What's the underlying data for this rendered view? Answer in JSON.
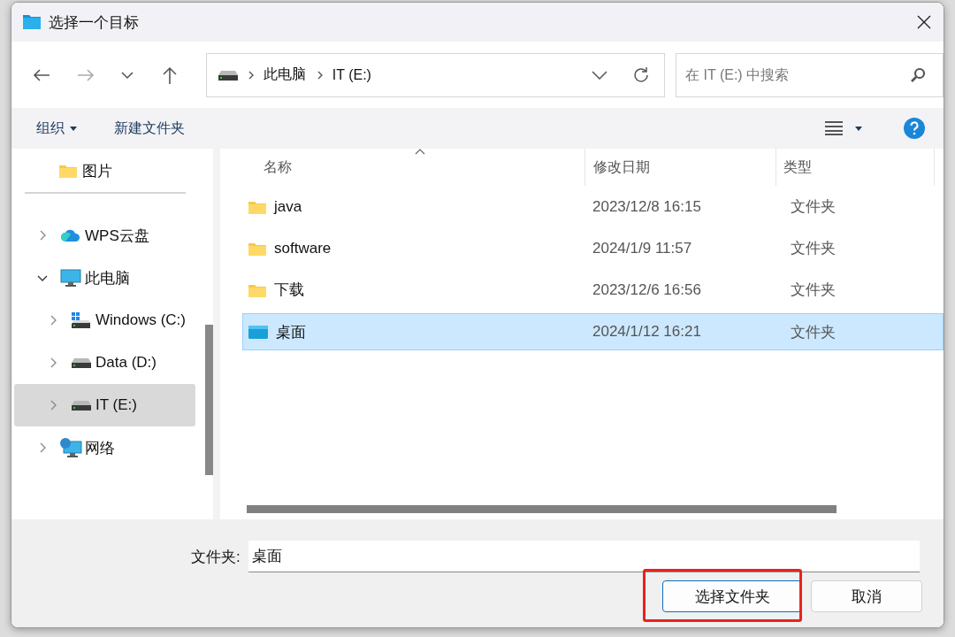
{
  "window": {
    "title": "选择一个目标"
  },
  "navigation": {
    "back_disabled": false,
    "forward_disabled": true
  },
  "address": {
    "path": [
      {
        "label": "此电脑"
      },
      {
        "label": "IT (E:)"
      }
    ]
  },
  "search": {
    "placeholder": "在 IT (E:) 中搜索"
  },
  "toolbar": {
    "organize": "组织",
    "new_folder": "新建文件夹"
  },
  "nav": {
    "pinned": [
      {
        "label": "图片",
        "kind": "folder"
      }
    ],
    "tree": [
      {
        "label": "WPS云盘",
        "kind": "cloud",
        "expanded": false,
        "selected": false
      },
      {
        "label": "此电脑",
        "kind": "pc",
        "expanded": true,
        "selected": false,
        "children": [
          {
            "label": "Windows (C:)",
            "kind": "windows-drive",
            "expanded": false,
            "selected": false
          },
          {
            "label": "Data (D:)",
            "kind": "drive",
            "expanded": false,
            "selected": false
          },
          {
            "label": "IT (E:)",
            "kind": "drive",
            "expanded": false,
            "selected": true
          }
        ]
      },
      {
        "label": "网络",
        "kind": "network",
        "expanded": false,
        "selected": false
      }
    ]
  },
  "table": {
    "columns": [
      "名称",
      "修改日期",
      "类型"
    ],
    "rows": [
      {
        "name": "java",
        "modified": "2023/12/8 16:15",
        "type": "文件夹",
        "kind": "folder",
        "selected": false
      },
      {
        "name": "software",
        "modified": "2024/1/9 11:57",
        "type": "文件夹",
        "kind": "folder",
        "selected": false
      },
      {
        "name": "下载",
        "modified": "2023/12/6 16:56",
        "type": "文件夹",
        "kind": "folder",
        "selected": false
      },
      {
        "name": "桌面",
        "modified": "2024/1/12 16:21",
        "type": "文件夹",
        "kind": "desktop",
        "selected": true
      }
    ]
  },
  "folder_field": {
    "label": "文件夹:",
    "value": "桌面"
  },
  "buttons": [
    {
      "label": "选择文件夹",
      "default": true,
      "highlighted": true
    },
    {
      "label": "取消",
      "default": false,
      "highlighted": false
    }
  ]
}
